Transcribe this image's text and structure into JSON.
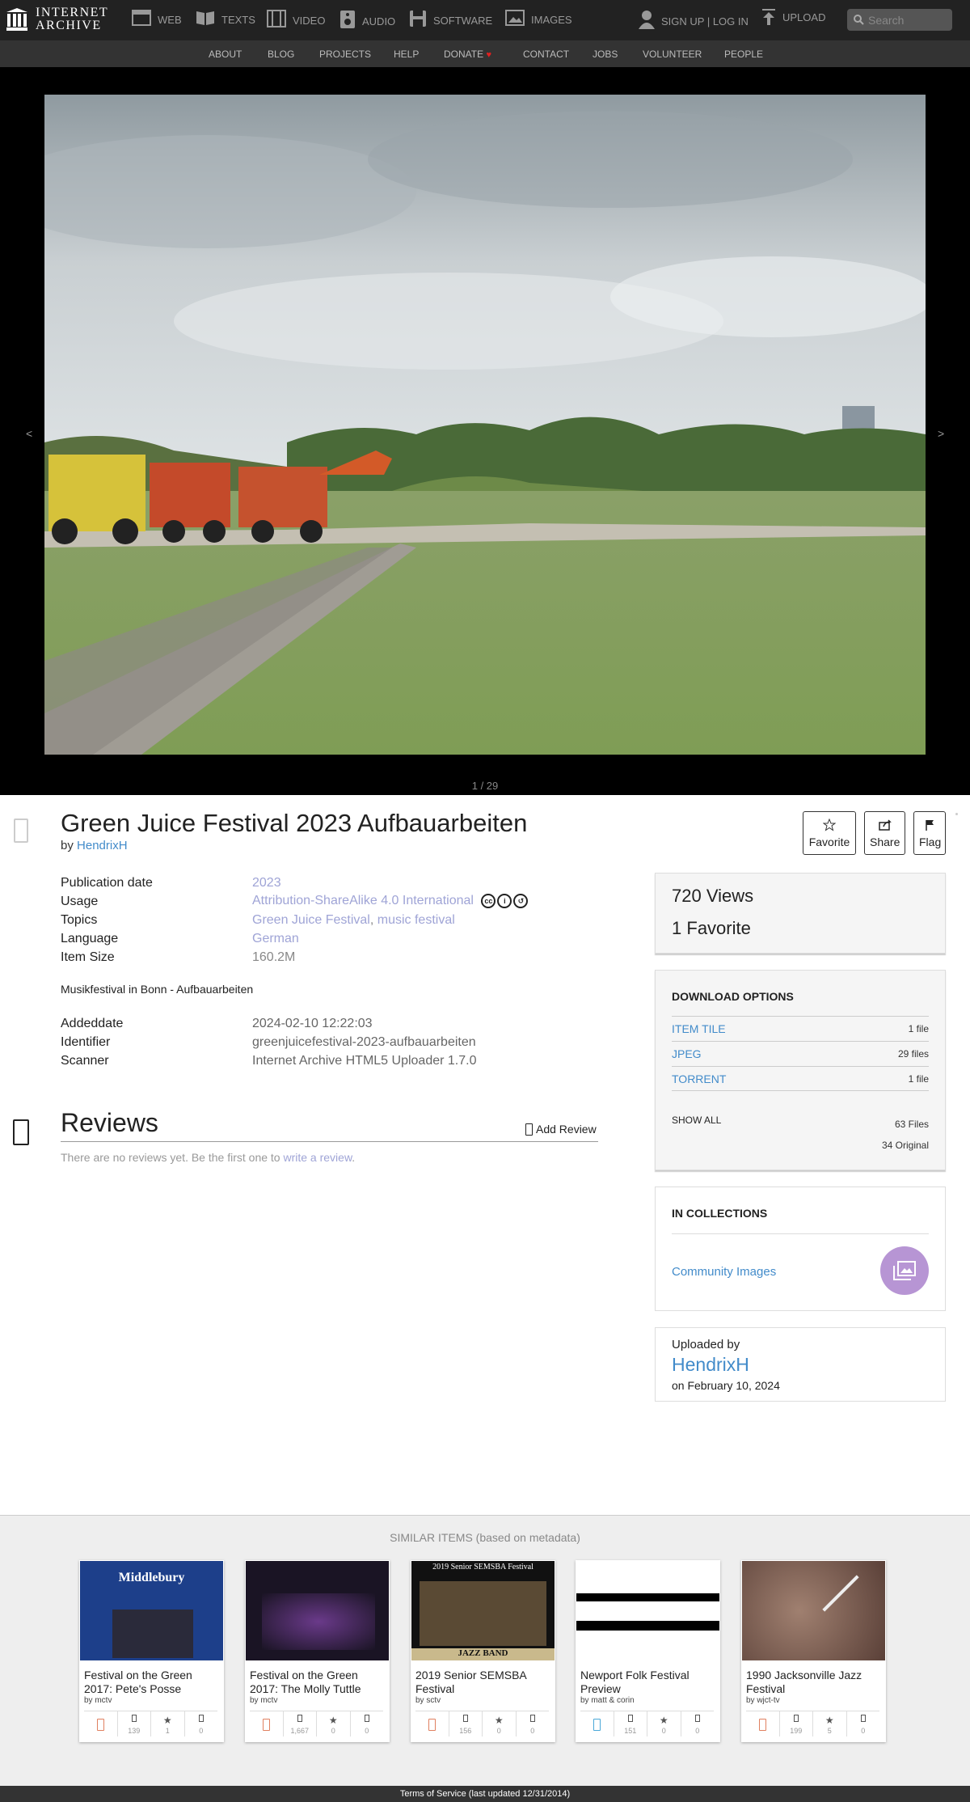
{
  "nav": {
    "logo_line1": "INTERNET",
    "logo_line2": "ARCHIVE",
    "items": [
      {
        "label": "WEB"
      },
      {
        "label": "TEXTS"
      },
      {
        "label": "VIDEO"
      },
      {
        "label": "AUDIO"
      },
      {
        "label": "SOFTWARE"
      },
      {
        "label": "IMAGES"
      }
    ],
    "signin": "SIGN UP | LOG IN",
    "upload": "UPLOAD",
    "search_placeholder": "Search"
  },
  "subnav": [
    "ABOUT",
    "BLOG",
    "PROJECTS",
    "HELP",
    "DONATE",
    "CONTACT",
    "JOBS",
    "VOLUNTEER",
    "PEOPLE"
  ],
  "viewer": {
    "prev": "<",
    "next": ">",
    "page_count": "1 / 29"
  },
  "item": {
    "title": "Green Juice Festival 2023 Aufbauarbeiten",
    "by_prefix": "by",
    "author": "HendrixH",
    "actions": {
      "favorite": "Favorite",
      "share": "Share",
      "flag": "Flag"
    },
    "metadata": [
      {
        "key": "Publication date",
        "value": "2023"
      },
      {
        "key": "Usage",
        "value": "Attribution-ShareAlike 4.0 International"
      },
      {
        "key": "Topics",
        "value1": "Green Juice Festival",
        "sep": ",",
        "value2": "music festival"
      },
      {
        "key": "Language",
        "value": "German"
      },
      {
        "key": "Item Size",
        "value": "160.2M"
      }
    ],
    "description": "Musikfestival in Bonn - Aufbauarbeiten",
    "metadata2": [
      {
        "key": "Addeddate",
        "value": "2024-02-10 12:22:03"
      },
      {
        "key": "Identifier",
        "value": "greenjuicefestival-2023-aufbauarbeiten"
      },
      {
        "key": "Scanner",
        "value": "Internet Archive HTML5 Uploader 1.7.0"
      }
    ]
  },
  "reviews": {
    "title": "Reviews",
    "add_label": "Add Review",
    "note_prefix": "There are no reviews yet. Be the first one to",
    "note_link": "write a review",
    "note_suffix": "."
  },
  "stats": {
    "views_count": "720",
    "views_label": "Views",
    "fav_count": "1",
    "fav_label": "Favorite"
  },
  "downloads": {
    "title": "DOWNLOAD OPTIONS",
    "rows": [
      {
        "name": "ITEM TILE",
        "count": "1 file"
      },
      {
        "name": "JPEG",
        "count": "29 files"
      },
      {
        "name": "TORRENT",
        "count": "1 file"
      }
    ],
    "show_all": "SHOW ALL",
    "total_files": "63 Files",
    "original": "34 Original"
  },
  "collections": {
    "title": "IN COLLECTIONS",
    "name": "Community Images"
  },
  "uploader": {
    "label": "Uploaded by",
    "name": "HendrixH",
    "date": "on February 10, 2024"
  },
  "similar": {
    "heading": "SIMILAR ITEMS (based on metadata)",
    "items": [
      {
        "title": "Festival on the Green 2017: Pete's Posse",
        "by": "by mctv",
        "views": "139",
        "favs": "1",
        "reviews": "0",
        "thumb_text": "Middlebury"
      },
      {
        "title": "Festival on the Green 2017: The Molly Tuttle",
        "by": "by mctv",
        "views": "1,667",
        "favs": "0",
        "reviews": "0",
        "thumb_text": ""
      },
      {
        "title": "2019 Senior SEMSBA Festival",
        "by": "by sctv",
        "views": "156",
        "favs": "0",
        "reviews": "0",
        "thumb_text": "2019 Senior SEMSBA Festival",
        "thumb_text2": "JAZZ BAND"
      },
      {
        "title": "Newport Folk Festival Preview",
        "by": "by matt & corin",
        "views": "151",
        "favs": "0",
        "reviews": "0",
        "thumb_text": ""
      },
      {
        "title": "1990 Jacksonville Jazz Festival",
        "by": "by wjct-tv",
        "views": "199",
        "favs": "5",
        "reviews": "0",
        "thumb_text": ""
      }
    ]
  },
  "footer": "Terms of Service (last updated 12/31/2014)",
  "colors": {
    "link": "#428bca",
    "muted_link": "#9fa4d6",
    "nav_bg": "#222222",
    "badge": "#b795d4"
  }
}
